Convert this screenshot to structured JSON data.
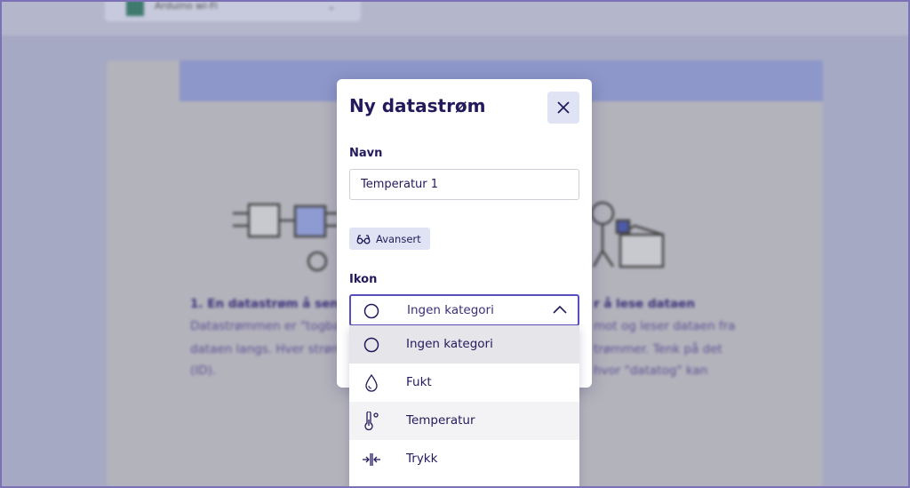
{
  "background": {
    "topbar_label": "Arduino wi-Fi",
    "section1_title": "1. En datastrøm å send",
    "section1_lines": [
      "Datastrømmen er \"togba",
      "dataen langs. Hver strøm",
      "(ID)."
    ],
    "section2_title": "r å lese dataen",
    "section2_lines": [
      "mot og leser dataen fra",
      "trømmer. Tenk på det",
      "hvor \"datatog\" kan"
    ]
  },
  "modal": {
    "title": "Ny datastrøm",
    "close_icon": "close-icon",
    "name_label": "Navn",
    "name_value": "Temperatur 1",
    "advanced_label": "Avansert",
    "icon_label": "Ikon",
    "icon_selected": "Ingen kategori"
  },
  "dropdown": {
    "options": [
      {
        "label": "Ingen kategori",
        "icon": "circle-icon",
        "state": "selected"
      },
      {
        "label": "Fukt",
        "icon": "droplet-icon",
        "state": "normal"
      },
      {
        "label": "Temperatur",
        "icon": "thermometer-icon",
        "state": "hover"
      },
      {
        "label": "Trykk",
        "icon": "pressure-icon",
        "state": "normal"
      }
    ]
  },
  "colors": {
    "accent": "#5a4fbf",
    "title": "#231a5c",
    "button_bg": "#dfe3f4"
  }
}
